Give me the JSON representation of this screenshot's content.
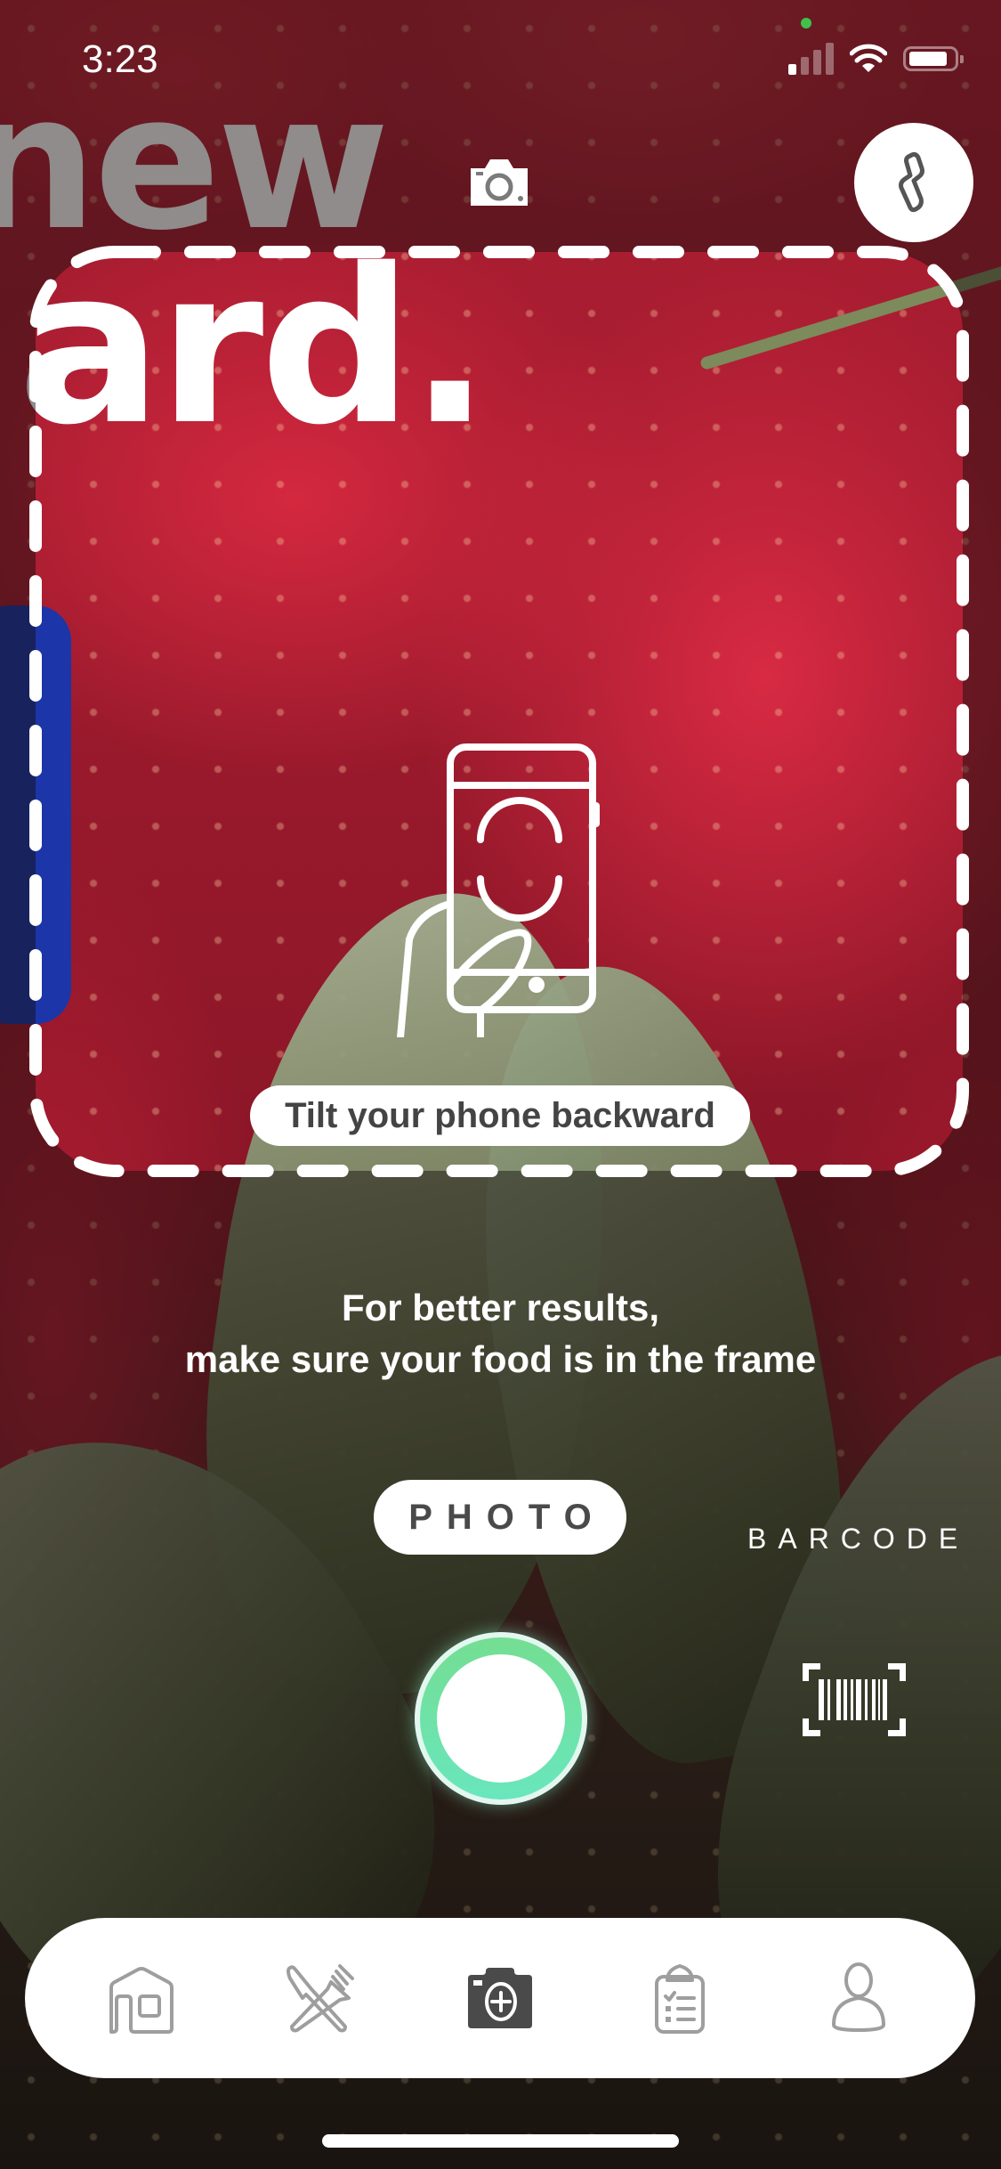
{
  "status_bar": {
    "time": "3:23",
    "signal_bars_active": 1,
    "signal_bars_total": 4,
    "wifi": "wifi-icon",
    "battery": "battery-icon",
    "privacy_indicator_color": "#3fc24a"
  },
  "camera": {
    "top_icon": "camera-icon",
    "flash_icon": "flash-icon",
    "scan_frame_style": "dashed"
  },
  "guidance": {
    "illustration": "hand-holding-phone-icon",
    "tilt_message": "Tilt your phone backward",
    "hint_line_1": "For better results,",
    "hint_line_2": "make sure your food is in the frame"
  },
  "modes": {
    "selected": "PHOTO",
    "photo_label": "PHOTO",
    "barcode_label": "BARCODE"
  },
  "controls": {
    "shutter_icon": "shutter-button",
    "barcode_icon": "barcode-scan-icon",
    "shutter_ring_color": "#6ee3a8"
  },
  "tab_bar": {
    "items": [
      {
        "name": "home",
        "icon": "home-icon",
        "active": false
      },
      {
        "name": "meals",
        "icon": "fork-knife-icon",
        "active": false
      },
      {
        "name": "camera",
        "icon": "camera-plus-icon",
        "active": true
      },
      {
        "name": "plan",
        "icon": "clipboard-list-icon",
        "active": false
      },
      {
        "name": "profile",
        "icon": "person-icon",
        "active": false
      }
    ],
    "active_color": "#4a4a4a",
    "inactive_color": "#9e9e9e"
  }
}
